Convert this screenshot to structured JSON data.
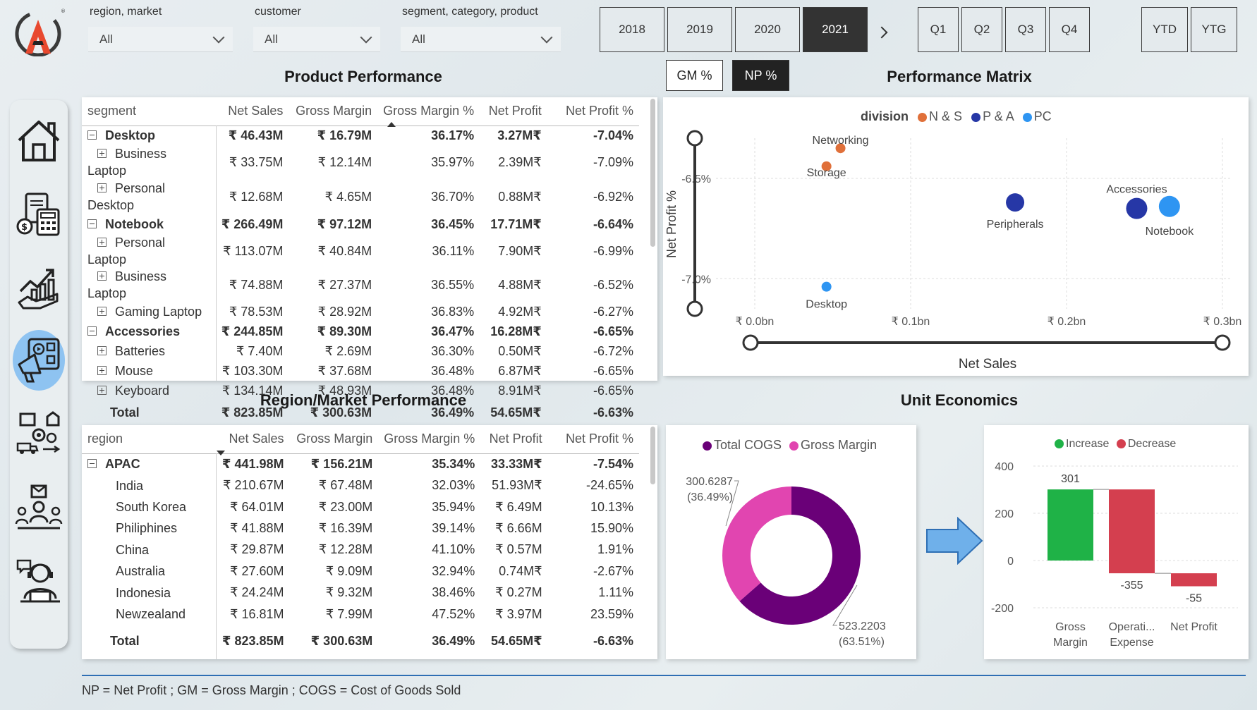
{
  "filters": [
    {
      "label": "region, market",
      "value": "All"
    },
    {
      "label": "customer",
      "value": "All"
    },
    {
      "label": "segment, category, product",
      "value": "All"
    }
  ],
  "years": [
    "2018",
    "2019",
    "2020",
    "2021"
  ],
  "active_year": "2021",
  "quarters": [
    "Q1",
    "Q2",
    "Q3",
    "Q4"
  ],
  "period_modes": [
    "YTD",
    "YTG"
  ],
  "toggles": {
    "gm": "GM %",
    "np": "NP %",
    "active": "NP %"
  },
  "titles": {
    "product": "Product Performance",
    "matrix": "Performance Matrix",
    "region": "Region/Market  Performance",
    "unit": "Unit Economics"
  },
  "product_table": {
    "headers": [
      "segment",
      "Net Sales",
      "Gross Margin",
      "Gross Margin %",
      "Net Profit",
      "Net Profit %"
    ],
    "rows": [
      {
        "level": 0,
        "cells": [
          "Desktop",
          "₹ 46.43M",
          "₹ 16.79M",
          "36.17%",
          "3.27M₹",
          "-7.04%"
        ]
      },
      {
        "level": 1,
        "cells": [
          "Business Laptop",
          "₹ 33.75M",
          "₹ 12.14M",
          "35.97%",
          "2.39M₹",
          "-7.09%"
        ]
      },
      {
        "level": 1,
        "cells": [
          "Personal Desktop",
          "₹ 12.68M",
          "₹ 4.65M",
          "36.70%",
          "0.88M₹",
          "-6.92%"
        ]
      },
      {
        "level": 0,
        "cells": [
          "Notebook",
          "₹ 266.49M",
          "₹ 97.12M",
          "36.45%",
          "17.71M₹",
          "-6.64%"
        ]
      },
      {
        "level": 1,
        "cells": [
          "Personal Laptop",
          "₹ 113.07M",
          "₹ 40.84M",
          "36.11%",
          "7.90M₹",
          "-6.99%"
        ]
      },
      {
        "level": 1,
        "cells": [
          "Business Laptop",
          "₹ 74.88M",
          "₹ 27.37M",
          "36.55%",
          "4.88M₹",
          "-6.52%"
        ]
      },
      {
        "level": 1,
        "cells": [
          "Gaming Laptop",
          "₹ 78.53M",
          "₹ 28.92M",
          "36.83%",
          "4.92M₹",
          "-6.27%"
        ]
      },
      {
        "level": 0,
        "cells": [
          "Accessories",
          "₹ 244.85M",
          "₹ 89.30M",
          "36.47%",
          "16.28M₹",
          "-6.65%"
        ]
      },
      {
        "level": 1,
        "cells": [
          "Batteries",
          "₹ 7.40M",
          "₹ 2.69M",
          "36.30%",
          "0.50M₹",
          "-6.72%"
        ]
      },
      {
        "level": 1,
        "cells": [
          "Mouse",
          "₹ 103.30M",
          "₹ 37.68M",
          "36.48%",
          "6.87M₹",
          "-6.65%"
        ]
      },
      {
        "level": 1,
        "cells": [
          "Keyboard",
          "₹ 134.14M",
          "₹ 48.93M",
          "36.48%",
          "8.91M₹",
          "-6.65%"
        ]
      }
    ],
    "total": [
      "Total",
      "₹ 823.85M",
      "₹ 300.63M",
      "36.49%",
      "54.65M₹",
      "-6.63%"
    ]
  },
  "region_table": {
    "headers": [
      "region",
      "Net Sales",
      "Gross Margin",
      "Gross Margin %",
      "Net Profit",
      "Net Profit %"
    ],
    "rows": [
      {
        "level": 0,
        "cells": [
          "APAC",
          "₹ 441.98M",
          "₹ 156.21M",
          "35.34%",
          "33.33M₹",
          "-7.54%"
        ]
      },
      {
        "level": 1,
        "cells": [
          "India",
          "₹ 210.67M",
          "₹ 67.48M",
          "32.03%",
          "51.93M₹",
          "-24.65%"
        ]
      },
      {
        "level": 1,
        "cells": [
          "South Korea",
          "₹ 64.01M",
          "₹ 23.00M",
          "35.94%",
          "₹ 6.49M",
          "10.13%"
        ]
      },
      {
        "level": 1,
        "cells": [
          "Philiphines",
          "₹ 41.88M",
          "₹ 16.39M",
          "39.14%",
          "₹ 6.66M",
          "15.90%"
        ]
      },
      {
        "level": 1,
        "cells": [
          "China",
          "₹ 29.87M",
          "₹ 12.28M",
          "41.10%",
          "₹ 0.57M",
          "1.91%"
        ]
      },
      {
        "level": 1,
        "cells": [
          "Australia",
          "₹ 27.60M",
          "₹ 9.09M",
          "32.94%",
          "0.74M₹",
          "-2.67%"
        ]
      },
      {
        "level": 1,
        "cells": [
          "Indonesia",
          "₹ 24.24M",
          "₹ 9.32M",
          "38.46%",
          "₹ 0.27M",
          "1.11%"
        ]
      },
      {
        "level": 1,
        "cells": [
          "Newzealand",
          "₹ 16.81M",
          "₹ 7.99M",
          "47.52%",
          "₹ 3.97M",
          "23.59%"
        ]
      }
    ],
    "total": [
      "Total",
      "₹ 823.85M",
      "₹ 300.63M",
      "36.49%",
      "54.65M₹",
      "-6.63%"
    ]
  },
  "chart_data": [
    {
      "type": "scatter",
      "title": "Performance Matrix",
      "xlabel": "Net Sales",
      "ylabel": "Net Profit %",
      "xlim": [
        0,
        0.3
      ],
      "ylim": [
        -7.15,
        -6.3
      ],
      "x_ticks": [
        "₹ 0.0bn",
        "₹ 0.1bn",
        "₹ 0.2bn",
        "₹ 0.3bn"
      ],
      "y_ticks": [
        "-6.5%",
        "-7.0%"
      ],
      "legend_title": "division",
      "legend": [
        {
          "name": "N & S",
          "color": "#e0703a"
        },
        {
          "name": "P & A",
          "color": "#2637a6"
        },
        {
          "name": "PC",
          "color": "#2e95f2"
        }
      ],
      "points": [
        {
          "label": "Networking",
          "division": "N & S",
          "x": 0.055,
          "y": -6.35,
          "size": 7
        },
        {
          "label": "Storage",
          "division": "N & S",
          "x": 0.046,
          "y": -6.44,
          "size": 7
        },
        {
          "label": "Desktop",
          "division": "PC",
          "x": 0.046,
          "y": -7.04,
          "size": 7
        },
        {
          "label": "Peripherals",
          "division": "P & A",
          "x": 0.167,
          "y": -6.62,
          "size": 13
        },
        {
          "label": "Accessories",
          "division": "P & A",
          "x": 0.245,
          "y": -6.65,
          "size": 15
        },
        {
          "label": "Notebook",
          "division": "PC",
          "x": 0.266,
          "y": -6.64,
          "size": 15
        }
      ]
    },
    {
      "type": "pie",
      "title": "",
      "legend": [
        {
          "name": "Total COGS",
          "color": "#6a0078"
        },
        {
          "name": "Gross Margin",
          "color": "#e145b0"
        }
      ],
      "slices": [
        {
          "name": "Total COGS",
          "value": 523.2203,
          "label": "523.2203",
          "percent": "(63.51%)"
        },
        {
          "name": "Gross Margin",
          "value": 300.6287,
          "label": "300.6287",
          "percent": "(36.49%)"
        }
      ]
    },
    {
      "type": "bar",
      "title": "",
      "legend": [
        {
          "name": "Increase",
          "color": "#1fb247"
        },
        {
          "name": "Decrease",
          "color": "#d43f4f"
        }
      ],
      "categories": [
        "Gross Margin",
        "Operati... Expense",
        "Net Profit"
      ],
      "category_lines": [
        [
          "Gross",
          "Margin"
        ],
        [
          "Operati...",
          "Expense"
        ],
        [
          "Net Profit"
        ]
      ],
      "values": [
        301,
        -355,
        -55
      ],
      "labels": [
        "301",
        "-355",
        "-55"
      ],
      "y_ticks": [
        400,
        200,
        0,
        -200
      ],
      "ylim": [
        -200,
        400
      ]
    }
  ],
  "footer": "NP = Net Profit ; GM = Gross Margin ; COGS = Cost of Goods Sold"
}
